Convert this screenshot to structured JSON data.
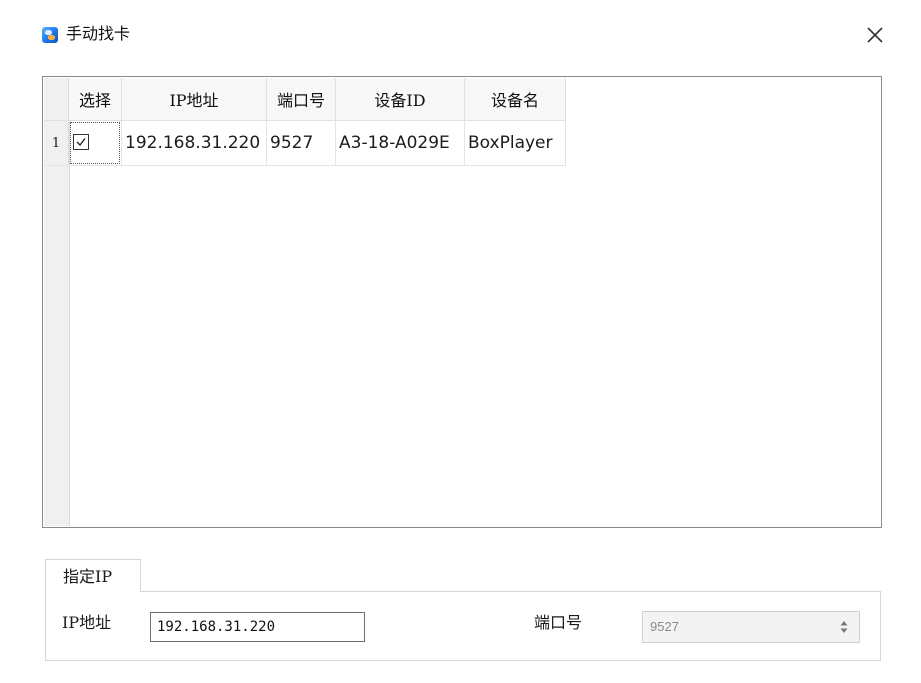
{
  "window": {
    "title": "手动找卡",
    "icon": "app-icon",
    "close_icon": "close-icon"
  },
  "grid": {
    "columns": [
      "选择",
      "IP地址",
      "端口号",
      "设备ID",
      "设备名"
    ],
    "rows": [
      {
        "row_number": "1",
        "selected": true,
        "ip": "192.168.31.220",
        "port": "9527",
        "device_id": "A3-18-A029E",
        "device_name": "BoxPlayer"
      }
    ]
  },
  "manual_ip": {
    "tab_label": "指定IP",
    "ip_label": "IP地址",
    "ip_value": "192.168.31.220",
    "port_label": "端口号",
    "port_value": "9527"
  }
}
